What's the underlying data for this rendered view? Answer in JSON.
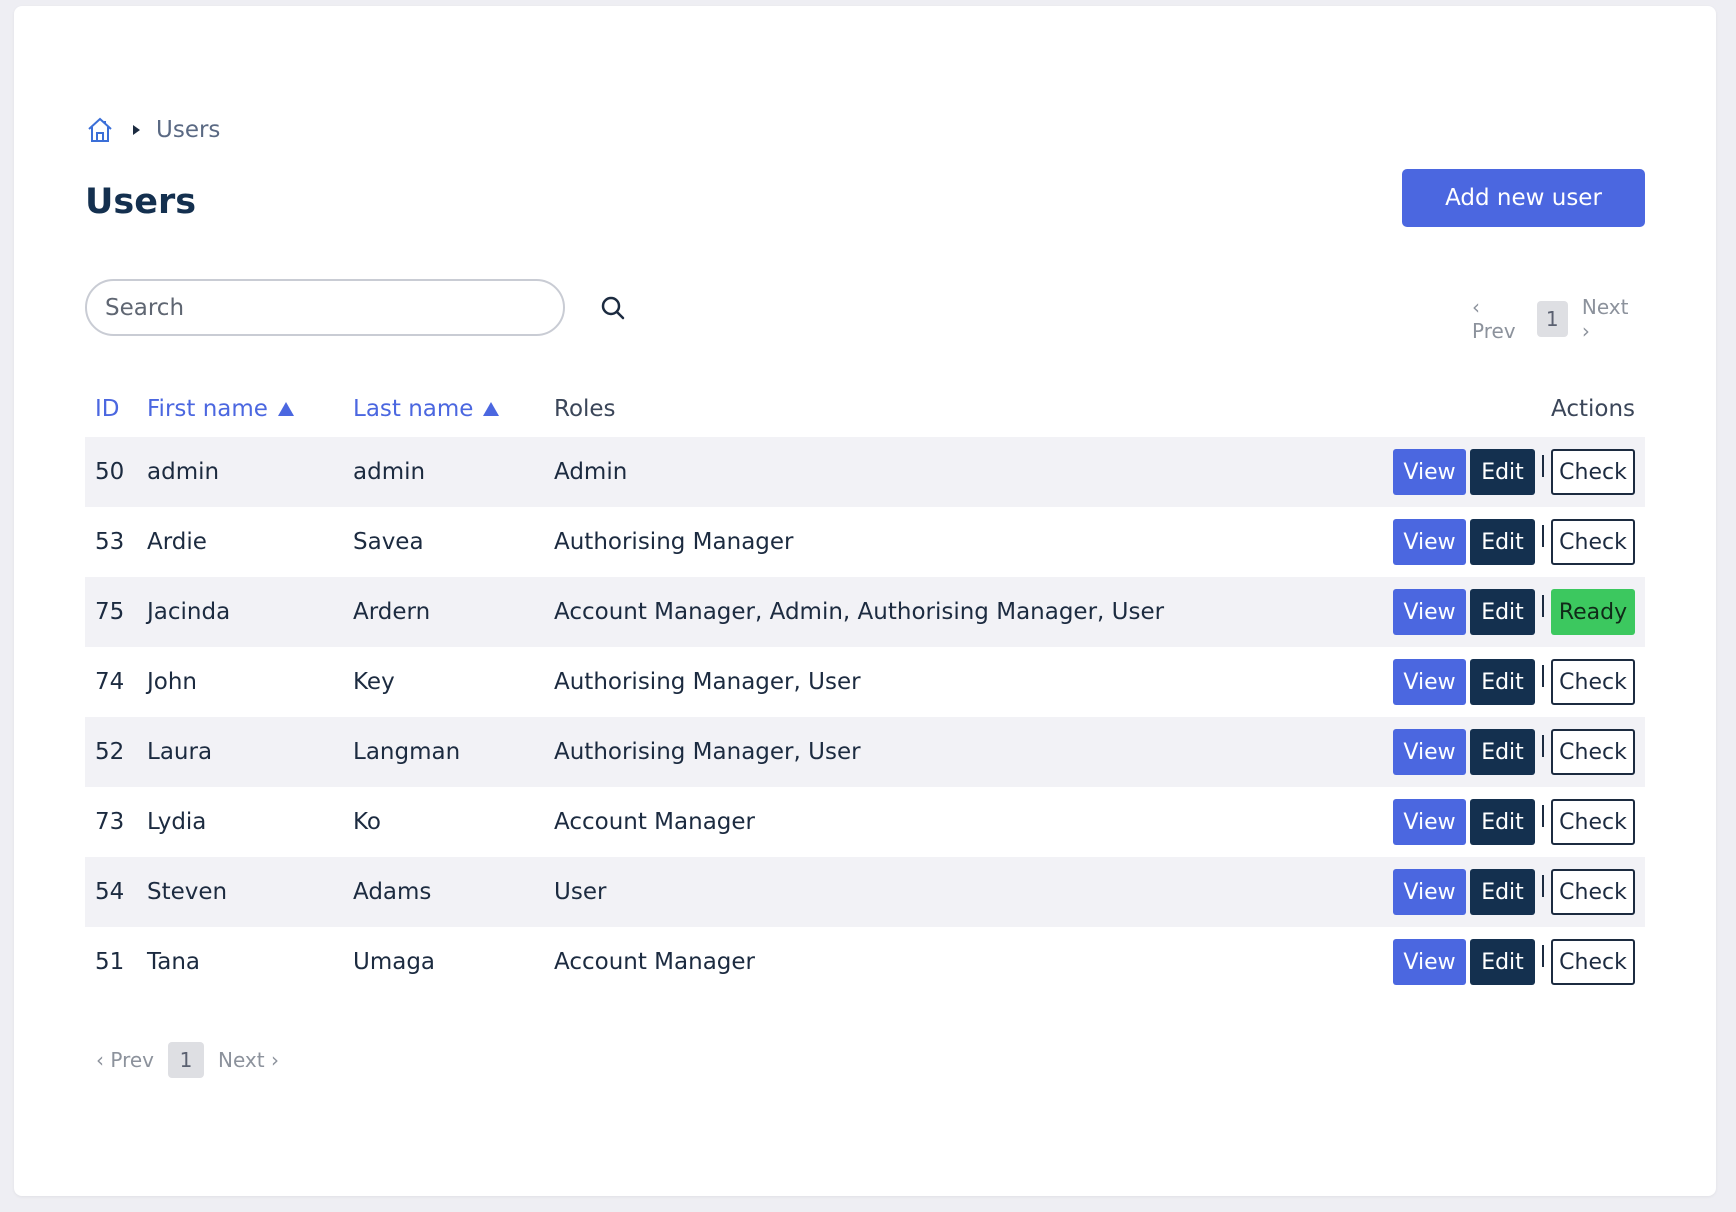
{
  "breadcrumb": {
    "home_icon": "home-icon",
    "current": "Users"
  },
  "page": {
    "title": "Users",
    "add_button": "Add new user"
  },
  "search": {
    "placeholder": "Search",
    "value": "",
    "icon": "search-icon"
  },
  "pagination": {
    "prev": "‹ Prev",
    "current_page": "1",
    "next": "Next ›"
  },
  "table": {
    "columns": {
      "id": "ID",
      "first_name": "First name",
      "last_name": "Last name",
      "roles": "Roles",
      "actions": "Actions"
    },
    "action_labels": {
      "view": "View",
      "edit": "Edit",
      "check": "Check",
      "ready": "Ready"
    },
    "rows": [
      {
        "id": "50",
        "first": "admin",
        "last": "admin",
        "roles": "Admin",
        "status": "Check"
      },
      {
        "id": "53",
        "first": "Ardie",
        "last": "Savea",
        "roles": "Authorising Manager",
        "status": "Check"
      },
      {
        "id": "75",
        "first": "Jacinda",
        "last": "Ardern",
        "roles": "Account Manager, Admin, Authorising Manager, User",
        "status": "Ready"
      },
      {
        "id": "74",
        "first": "John",
        "last": "Key",
        "roles": "Authorising Manager, User",
        "status": "Check"
      },
      {
        "id": "52",
        "first": "Laura",
        "last": "Langman",
        "roles": "Authorising Manager, User",
        "status": "Check"
      },
      {
        "id": "73",
        "first": "Lydia",
        "last": "Ko",
        "roles": "Account Manager",
        "status": "Check"
      },
      {
        "id": "54",
        "first": "Steven",
        "last": "Adams",
        "roles": "User",
        "status": "Check"
      },
      {
        "id": "51",
        "first": "Tana",
        "last": "Umaga",
        "roles": "Account Manager",
        "status": "Check"
      }
    ]
  },
  "colors": {
    "accent": "#4b67e0",
    "dark": "#14304f",
    "ready": "#3cc85f"
  }
}
